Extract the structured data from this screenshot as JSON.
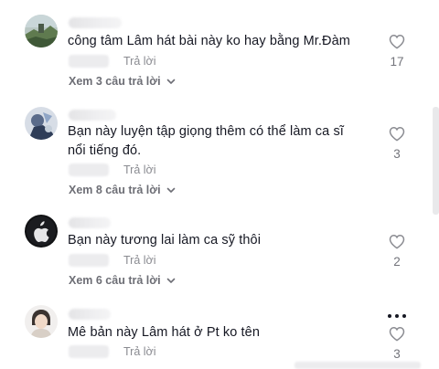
{
  "comments": [
    {
      "text": "công tâm Lâm hát bài này ko hay bằng Mr.Đàm",
      "reply_label": "Trả lời",
      "view_replies": "Xem 3 câu trả lời",
      "likes": "17"
    },
    {
      "text": "Bạn này luyện tập giọng thêm có thể làm ca sĩ nổi tiếng đó.",
      "reply_label": "Trả lời",
      "view_replies": "Xem 8 câu trả lời",
      "likes": "3"
    },
    {
      "text": "Bạn này tương lai làm ca sỹ thôi",
      "reply_label": "Trả lời",
      "view_replies": "Xem 6 câu trả lời",
      "likes": "2"
    },
    {
      "text": "Mê bản này Lâm hát ở Pt ko tên",
      "reply_label": "Trả lời",
      "likes": "3"
    }
  ],
  "icons": {
    "like": "heart-outline-icon",
    "expand": "chevron-down-icon",
    "more": "more-dots-icon"
  },
  "colors": {
    "text": "#161823",
    "muted": "#8a8b91"
  }
}
